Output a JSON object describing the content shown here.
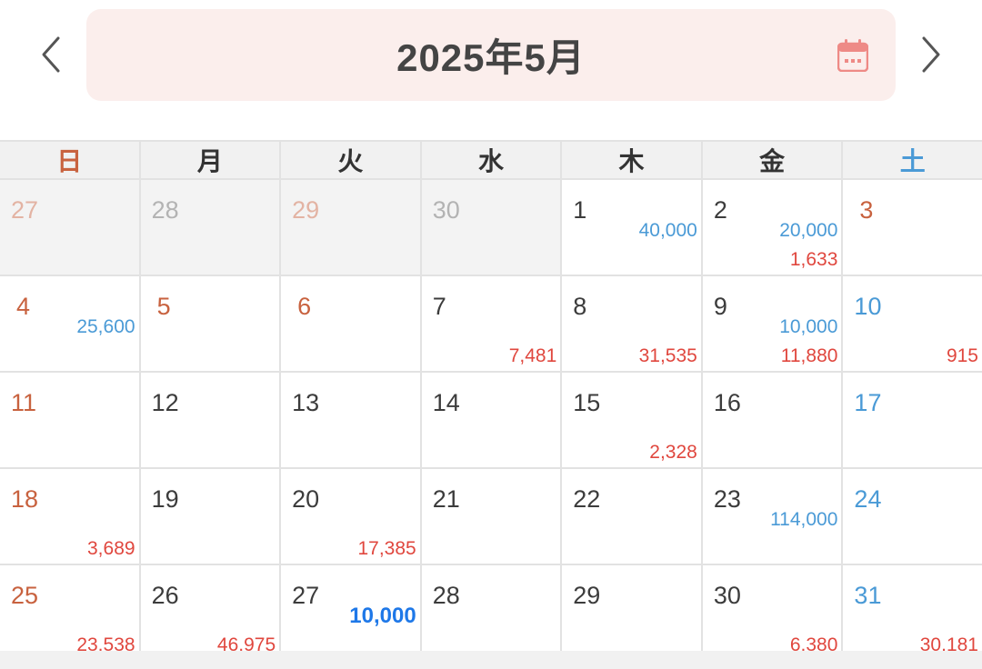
{
  "header": {
    "title": "2025年5月",
    "prev_icon": "chevron-left-icon",
    "next_icon": "chevron-right-icon",
    "calendar_icon": "calendar-icon"
  },
  "colors": {
    "title_bg": "#fbeeec",
    "sunday_holiday": "#c8623f",
    "saturday": "#4a9ad6",
    "income": "#4a9ad6",
    "expense": "#e0473e",
    "calendar_icon": "#ee8a86"
  },
  "weekdays": [
    "日",
    "月",
    "火",
    "水",
    "木",
    "金",
    "土"
  ],
  "days": [
    {
      "n": "27",
      "other": true,
      "kind": "sun"
    },
    {
      "n": "28",
      "other": true
    },
    {
      "n": "29",
      "other": true,
      "kind": "tue"
    },
    {
      "n": "30",
      "other": true
    },
    {
      "n": "1",
      "income": "40,000"
    },
    {
      "n": "2",
      "income": "20,000",
      "expense": "1,633"
    },
    {
      "n": "3",
      "kind": "hol"
    },
    {
      "n": "4",
      "kind": "hol",
      "income": "25,600"
    },
    {
      "n": "5",
      "kind": "hol"
    },
    {
      "n": "6",
      "kind": "hol"
    },
    {
      "n": "7",
      "expense": "7,481"
    },
    {
      "n": "8",
      "expense": "31,535"
    },
    {
      "n": "9",
      "income": "10,000",
      "expense": "11,880"
    },
    {
      "n": "10",
      "kind": "sat",
      "expense": "915"
    },
    {
      "n": "11",
      "kind": "sun"
    },
    {
      "n": "12"
    },
    {
      "n": "13"
    },
    {
      "n": "14"
    },
    {
      "n": "15",
      "expense": "2,328"
    },
    {
      "n": "16"
    },
    {
      "n": "17",
      "kind": "sat"
    },
    {
      "n": "18",
      "kind": "sun",
      "expense": "3,689"
    },
    {
      "n": "19"
    },
    {
      "n": "20",
      "expense": "17,385"
    },
    {
      "n": "21"
    },
    {
      "n": "22"
    },
    {
      "n": "23",
      "income": "114,000"
    },
    {
      "n": "24",
      "kind": "sat"
    },
    {
      "n": "25",
      "kind": "sun",
      "expense": "23,538"
    },
    {
      "n": "26",
      "expense": "46,975"
    },
    {
      "n": "27",
      "income": "10,000",
      "income_bold": true
    },
    {
      "n": "28"
    },
    {
      "n": "29"
    },
    {
      "n": "30",
      "expense": "6,380"
    },
    {
      "n": "31",
      "kind": "sat",
      "expense": "30,181"
    }
  ]
}
